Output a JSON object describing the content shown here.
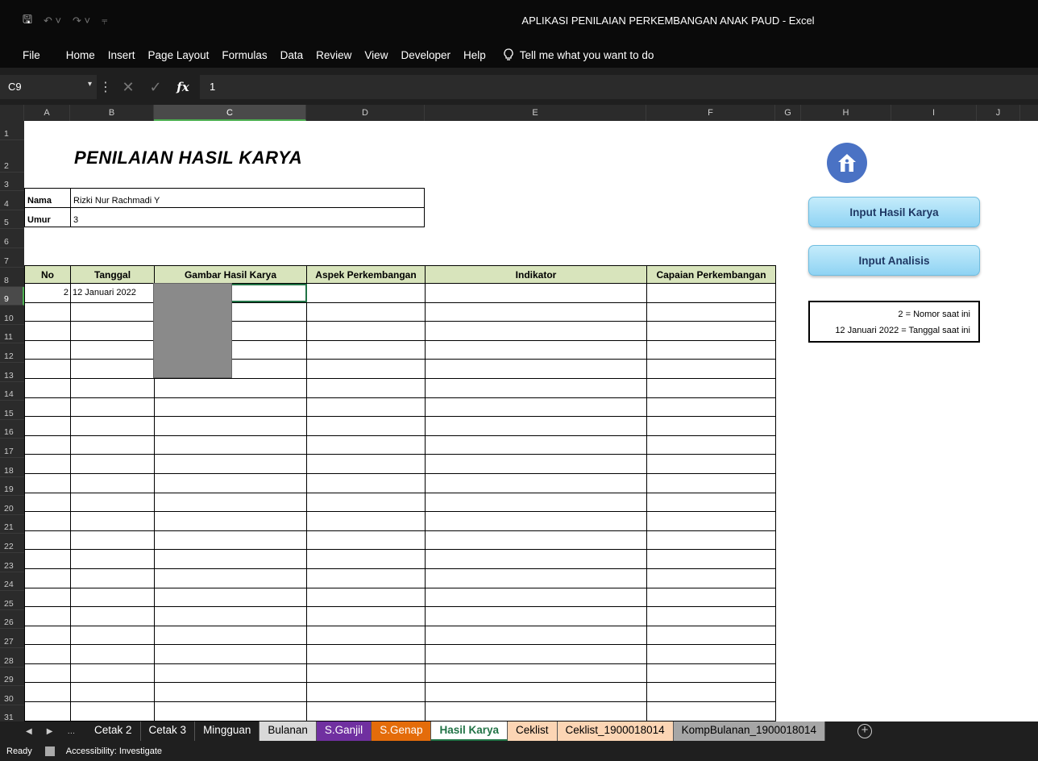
{
  "app_title": "APLIKASI PENILAIAN PERKEMBANGAN ANAK PAUD  -  Excel",
  "qat": {
    "save_icon": "save-icon",
    "undo_icon": "undo-icon",
    "redo_icon": "redo-icon",
    "customize_icon": "customize-icon"
  },
  "menu": [
    "File",
    "Home",
    "Insert",
    "Page Layout",
    "Formulas",
    "Data",
    "Review",
    "View",
    "Developer",
    "Help"
  ],
  "tell_me": "Tell me what you want to do",
  "formula_bar": {
    "name_box": "C9",
    "value": "1"
  },
  "columns": [
    "A",
    "B",
    "C",
    "D",
    "E",
    "F",
    "G",
    "H",
    "I",
    "J"
  ],
  "selected_column": "C",
  "selected_row": 9,
  "sheet": {
    "title": "PENILAIAN HASIL KARYA",
    "nama_label": "Nama",
    "nama_value": "Rizki Nur Rachmadi Y",
    "umur_label": "Umur",
    "umur_value": "3",
    "table_headers": [
      "No",
      "Tanggal",
      "Gambar Hasil Karya",
      "Aspek Perkembangan",
      "Indikator",
      "Capaian Perkembangan"
    ],
    "first_row": {
      "no": "2",
      "tanggal": "12 Januari 2022"
    },
    "buttons": {
      "input_hasil_karya": "Input Hasil Karya",
      "input_analisis": "Input Analisis"
    },
    "legend": {
      "line1": "2 = Nomor saat ini",
      "line2": "12 Januari 2022 = Tanggal saat ini"
    }
  },
  "tabs": [
    "Cetak 2",
    "Cetak 3",
    "Mingguan",
    "Bulanan",
    "S.Ganjil",
    "S.Genap",
    "Hasil Karya",
    "Ceklist",
    "Ceklist_1900018014",
    "KompBulanan_1900018014"
  ],
  "active_tab": "Hasil Karya",
  "tab_colors": {
    "Bulanan": "#d9d9d9",
    "S.Ganjil": "#7030a0",
    "S.Genap": "#e46c0a",
    "Ceklist": "#fcd5b4",
    "Ceklist_1900018014": "#fcd5b4",
    "KompBulanan_1900018014": "#a6a6a6"
  },
  "status": {
    "ready": "Ready",
    "accessibility": "Accessibility: Investigate"
  }
}
